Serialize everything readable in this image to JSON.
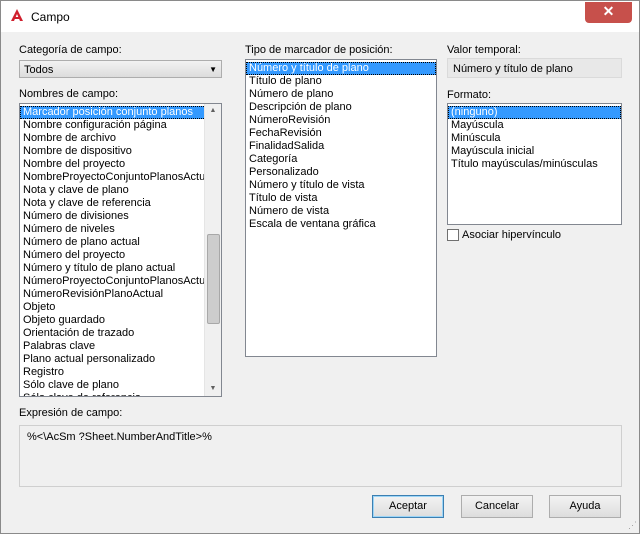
{
  "window": {
    "title": "Campo"
  },
  "category": {
    "label": "Categoría de campo:",
    "selected": "Todos"
  },
  "field_names": {
    "label": "Nombres de campo:",
    "items": [
      "Marcador posición conjunto planos",
      "Nombre configuración página",
      "Nombre de archivo",
      "Nombre de dispositivo",
      "Nombre del proyecto",
      "NombreProyectoConjuntoPlanosActual",
      "Nota y clave de plano",
      "Nota y clave de referencia",
      "Número de divisiones",
      "Número de niveles",
      "Número de plano actual",
      "Número del proyecto",
      "Número y título de plano actual",
      "NúmeroProyectoConjuntoPlanosActual",
      "NúmeroRevisiónPlanoActual",
      "Objeto",
      "Objeto guardado",
      "Orientación de trazado",
      "Palabras clave",
      "Plano actual personalizado",
      "Registro",
      "Sólo clave de plano",
      "Sólo clave de referencia"
    ],
    "selected_index": 0
  },
  "placeholder_type": {
    "label": "Tipo de marcador de posición:",
    "items": [
      "Número y título de plano",
      "Título de plano",
      "Número de plano",
      "Descripción de plano",
      "NúmeroRevisión",
      "FechaRevisión",
      "FinalidadSalida",
      "Categoría",
      "Personalizado",
      "Número y título de vista",
      "Título de vista",
      "Número de vista",
      "Escala de ventana gráfica"
    ],
    "selected_index": 0
  },
  "temp_value": {
    "label": "Valor temporal:",
    "value": "Número y título de plano"
  },
  "format": {
    "label": "Formato:",
    "items": [
      "(ninguno)",
      "Mayúscula",
      "Minúscula",
      "Mayúscula inicial",
      "Título mayúsculas/minúsculas"
    ],
    "selected_index": 0
  },
  "hyperlink": {
    "label": "Asociar hipervínculo",
    "checked": false
  },
  "expression": {
    "label": "Expresión de campo:",
    "value": "%<\\AcSm ?Sheet.NumberAndTitle>%"
  },
  "buttons": {
    "ok": "Aceptar",
    "cancel": "Cancelar",
    "help": "Ayuda"
  },
  "colors": {
    "selection": "#3399ff",
    "close_button": "#c7504b",
    "app_icon": "#d0202e"
  }
}
